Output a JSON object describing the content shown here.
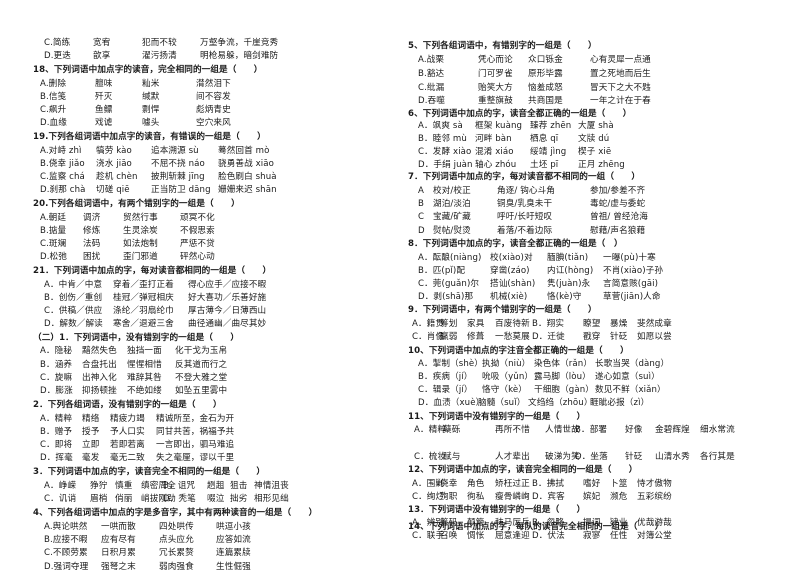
{
  "left": {
    "lines": [
      {
        "type": "opt",
        "cells": [
          "C.简练",
          "宽宥",
          "犯而不较",
          "万壑争流，千崖竞秀"
        ]
      },
      {
        "type": "opt",
        "cells": [
          "D.更迭",
          "歆享",
          "濯污扬清",
          "明枪易躲，暗剑难防"
        ]
      },
      {
        "type": "q",
        "text": "18、下列词语中加点字的读音，完全相同的一组是（　　）"
      },
      {
        "type": "opt",
        "cells": [
          "A.删除",
          "膻味",
          "籼米",
          "潸然泪下"
        ]
      },
      {
        "type": "opt",
        "cells": [
          "B.信笺",
          "歼灭",
          "缄默",
          "间不容发"
        ]
      },
      {
        "type": "opt",
        "cells": [
          "C.飙升",
          "鱼鳔",
          "剽悍",
          "彪炳青史"
        ]
      },
      {
        "type": "opt",
        "cells": [
          "D.血缘",
          "戏谑",
          "噱头",
          "空穴来风"
        ]
      },
      {
        "type": "q",
        "text": "19.下列各组词语中加点字的读音，有错误的一组是（　　）"
      },
      {
        "type": "opt",
        "cells": [
          "A.对峙 zhì",
          "犒劳 kào",
          "追本溯源 sù",
          "蓦然回首 mò"
        ]
      },
      {
        "type": "opt",
        "cells": [
          "B.侥幸 jiǎo",
          "浇水 jiāo",
          "不屈不挠 náo",
          "骁勇善战 xiāo"
        ]
      },
      {
        "type": "opt",
        "cells": [
          "C.监察 chá",
          "趁机 chèn",
          "披荆斩棘 jīng",
          "脸色刷白 shuà"
        ]
      },
      {
        "type": "opt",
        "cells": [
          "D.刹那 chà",
          "切磋 qiē",
          "正当防卫 dāng",
          "姗姗来迟 shān"
        ]
      },
      {
        "type": "q",
        "text": "20.下列各组词语中，有两个错别字的一组是（　　）"
      },
      {
        "type": "opt",
        "cells": [
          "A.朝廷",
          "调济",
          "贸然行事",
          "顽冥不化"
        ]
      },
      {
        "type": "opt",
        "cells": [
          "B.掂量",
          "修炼",
          "生灵涂炭",
          "不假思索"
        ]
      },
      {
        "type": "opt",
        "cells": [
          "C.斑斓",
          "法码",
          "如法炮制",
          "严惩不贷"
        ]
      },
      {
        "type": "opt",
        "cells": [
          "D.松弛",
          "困扰",
          "歪门邪道",
          "砰然心动"
        ]
      },
      {
        "type": "q",
        "text": "21．下列词语中加点的字，每对读音都相同的一组是（　　）"
      },
      {
        "type": "opt",
        "cells": [
          "A．中肯／中意",
          "穿着／歪打正着",
          "得心应手／应接不暇"
        ]
      },
      {
        "type": "opt",
        "cells": [
          "B．创伤／重创",
          "桂冠／弹冠相庆",
          "好大喜功／乐善好施"
        ]
      },
      {
        "type": "opt",
        "cells": [
          "C．供稿／供应",
          "涤纶／羽扇纶巾",
          "厚古薄今／日薄西山"
        ]
      },
      {
        "type": "opt",
        "cells": [
          "D．解数／解读",
          "寒舍／退避三舍",
          "曲径通幽／曲尽其妙"
        ]
      },
      {
        "type": "q",
        "text": "（二）1．下列词语中，没有错别字的一组是（　　）"
      },
      {
        "type": "opt",
        "cells": [
          "A．隐秘",
          "黯然失色",
          "独挡一面",
          "化干戈为玉帛"
        ]
      },
      {
        "type": "opt",
        "cells": [
          "B．涵养",
          "合盘托出",
          "惺惺相惜",
          "反其道而行之"
        ]
      },
      {
        "type": "opt",
        "cells": [
          "C．旋嘛",
          "出神入化",
          "难辞其咎",
          "不登大雅之堂"
        ]
      },
      {
        "type": "opt",
        "cells": [
          "D．膨涨",
          "抑扬顿挫",
          "不绝如缕",
          "如坠五里雾中"
        ]
      },
      {
        "type": "q",
        "text": "2．下列各组词语，没有错别字的一组是（　　）"
      },
      {
        "type": "opt",
        "cells": [
          "A．精粹",
          "精络",
          "精疲力竭",
          "精诚所至，金石为开"
        ]
      },
      {
        "type": "opt",
        "cells": [
          "B．赠予",
          "授予",
          "予人口实",
          "同甘共苦，祸福予共"
        ]
      },
      {
        "type": "opt",
        "cells": [
          "C．即将",
          "立即",
          "若即若离",
          "一言即出，驷马难追"
        ]
      },
      {
        "type": "opt",
        "cells": [
          "D．挥毫",
          "毫发",
          "毫无二致",
          "失之毫厘，谬以千里"
        ]
      },
      {
        "type": "q",
        "text": "3．下列词语中加点的字，读音完全不相同的一组是（　　）"
      },
      {
        "type": "opt",
        "cells": [
          "A．峥嵘",
          "狰狞",
          "慎重",
          "缜密周全",
          "B．诅咒",
          "趔趄",
          "狙击",
          "神情沮丧"
        ]
      },
      {
        "type": "opt",
        "cells": [
          "C．讥诮",
          "眉梢",
          "俏丽",
          "峭拔刚劲",
          "D．秃笔",
          "啜泣",
          "拙劣",
          "相形见绌"
        ]
      },
      {
        "type": "q",
        "text": "4、下列各组词语中加点的字是多音字，其中有两种读音的一组是（　　）"
      },
      {
        "type": "opt",
        "cells": [
          "A.舆论哄然",
          "一哄而散",
          "四处哄传",
          "哄逗小孩"
        ]
      },
      {
        "type": "opt",
        "cells": [
          "B.应接不暇",
          "应有尽有",
          "点头应允",
          "应答如流"
        ]
      },
      {
        "type": "opt",
        "cells": [
          "C.不顾劳累",
          "日积月累",
          "冗长累赘",
          "连篇累牍"
        ]
      },
      {
        "type": "opt",
        "cells": [
          "D.强词夺理",
          "强弩之末",
          "弱肉强食",
          "生性倔强"
        ]
      }
    ]
  },
  "right": {
    "lines": [
      {
        "type": "q",
        "text": "5、下列各组词语中，有错别字的一组是（　　）"
      },
      {
        "type": "opt",
        "cells": [
          "A.战栗",
          "凭心而论",
          "众口铄金",
          "心有灵犀一点通"
        ]
      },
      {
        "type": "opt",
        "cells": [
          "B.豁达",
          "门可罗雀",
          "原形毕露",
          "置之死地而后生"
        ]
      },
      {
        "type": "opt",
        "cells": [
          "C.纰漏",
          "贻笑大方",
          "恼羞成怒",
          "冒天下之大不韪"
        ]
      },
      {
        "type": "opt",
        "cells": [
          "D.吞噬",
          "重整旗鼓",
          "共商国是",
          "一年之计在于春"
        ]
      },
      {
        "type": "q",
        "text": "6、下列词语中加点的字，读音全都正确的一组是（　　）"
      },
      {
        "type": "opt",
        "cells": [
          "A．飒爽 sà",
          "框架 kuàng",
          "臻荐 zhēn",
          "大厦 shà"
        ]
      },
      {
        "type": "opt",
        "cells": [
          "B．睦邻 mù",
          "河畔 bàn",
          "栖息 qī",
          "文牍 dú"
        ]
      },
      {
        "type": "opt",
        "cells": [
          "C．发酵 xiào",
          "混淆 xiáo",
          "绥靖 jìng",
          "楔子 xiē"
        ]
      },
      {
        "type": "opt",
        "cells": [
          "D．手绢 juàn",
          "轴心 zhóu",
          "土坯 pī",
          "正月 zhēng"
        ]
      },
      {
        "type": "q",
        "text": "7．下列词语中加点的字，每对读音都不相同的一组（　　）"
      },
      {
        "type": "opt",
        "cells": [
          "A",
          "校对/校正",
          "角逐/ 钩心斗角",
          "参加/参差不齐"
        ]
      },
      {
        "type": "opt",
        "cells": [
          "B",
          "湖泊/淡泊",
          "铜臭/乳臭未干",
          "毒蛇/虚与委蛇"
        ]
      },
      {
        "type": "opt",
        "cells": [
          "C",
          "宝藏/矿藏",
          "呼吁/长吁短叹",
          "曾祖/ 曾经沧海"
        ]
      },
      {
        "type": "opt",
        "cells": [
          "D",
          "熨帖/熨烫",
          "着落/不着边际",
          "慰藉/声名狼藉"
        ]
      },
      {
        "type": "q",
        "text": "8．下列词语中加点的字，读音全都正确的一组是（　）"
      },
      {
        "type": "opt",
        "cells": [
          "A．酝酿(niàng)",
          "校(xiào)对",
          "腼腆(tiǎn)",
          "一曝(pù)十寒"
        ]
      },
      {
        "type": "opt",
        "cells": [
          "B．匹(pǐ)配",
          "穿凿(záo)",
          "内讧(hòng)",
          "不肖(xiào)子孙"
        ]
      },
      {
        "type": "opt",
        "cells": [
          "C．莞(guǎn)尔",
          "搭讪(shàn)",
          "隽(juàn)永",
          "言简意赅(gāi)"
        ]
      },
      {
        "type": "opt",
        "cells": [
          "D．剥(shā)那",
          "机械(xiè)",
          "恪(kè)守",
          "草菅(jiān)人命"
        ]
      },
      {
        "type": "q",
        "text": "9．下列词语中，有两个错别字的一组是（　　）"
      },
      {
        "type": "opt",
        "cells": [
          "A．籍贯",
          "筹划",
          "家具",
          "百废待新",
          "B．翔实",
          "瞭望",
          "暴燥",
          "斐然成章"
        ]
      },
      {
        "type": "opt",
        "cells": [
          "C．肖像",
          "赢弱",
          "修葺",
          "一愁莫展",
          "D．迁徙",
          "戳穿",
          "针砭",
          "如愿以尝"
        ]
      },
      {
        "type": "q",
        "text": "10、下列词语中加点的字注音全都正确的一组是（　　）"
      },
      {
        "type": "opt",
        "cells": [
          "A．掣制（shè）",
          "执拗（niù）",
          "染色体（rǎn）",
          "长歌当哭（dàng）"
        ]
      },
      {
        "type": "opt",
        "cells": [
          "B．疾病（jí）",
          "吮吸（yǔn）",
          "露马脚（lòu）",
          "遂心如意（suì）"
        ]
      },
      {
        "type": "opt",
        "cells": [
          "C．辑录（jí）",
          "恪守（kè）",
          "干细胞（gàn）",
          "数见不鲜（xiǎn）"
        ]
      },
      {
        "type": "opt",
        "cells": [
          "D．血渍（xuè）",
          "脑髓（suǐ）",
          "文绉绉（zhōu）",
          "睚眦必报（zì）"
        ]
      },
      {
        "type": "q",
        "text": "11、下列词语中没有错别字的一组是（　　）"
      },
      {
        "type": "opt",
        "cells": [
          "A．精粹",
          "蘖砾",
          "再所不惜",
          "人情世故",
          "B．部署",
          "好像",
          "金碧辉煌",
          "细水常流"
        ]
      },
      {
        "type": "opt",
        "cells": [
          "C．梳妆",
          "赋与",
          "人才辈出",
          "破涕为笑",
          "D．坐落",
          "针砭",
          "山清水秀",
          "各行其是"
        ]
      },
      {
        "type": "q",
        "text": "12、下列词语中加点的字，读音完全相同的一组是（　　）"
      },
      {
        "type": "opt",
        "cells": [
          "A．围剿",
          "侥幸",
          "角色",
          "矫枉过正",
          "B．拂拭",
          "嗜好",
          "卜筮",
          "恃才傲物"
        ]
      },
      {
        "type": "opt",
        "cells": [
          "C．绚烂",
          "殉职",
          "徇私",
          "瘦骨嶙峋",
          "D．宾客",
          "嫔妃",
          "濒危",
          "五彩缤纷"
        ]
      },
      {
        "type": "q",
        "text": "13．下列词语中没有错别字的一组是（　　）"
      },
      {
        "type": "opt",
        "cells": [
          "A．辨别",
          "筹码",
          "颠簸",
          "秣马厉兵",
          "B．忽略",
          "提词",
          "肄业",
          "优哉游哉"
        ]
      },
      {
        "type": "opt",
        "cells": [
          "C．联手",
          "召唤",
          "惆怅",
          "屈意逢迎",
          "D．伏法",
          "寂寥",
          "任性",
          "对簿公堂"
        ]
      },
      {
        "type": "q",
        "text": "14、下列词语中加点的字，每队的读音完全相同的一组是（　　）"
      }
    ]
  }
}
